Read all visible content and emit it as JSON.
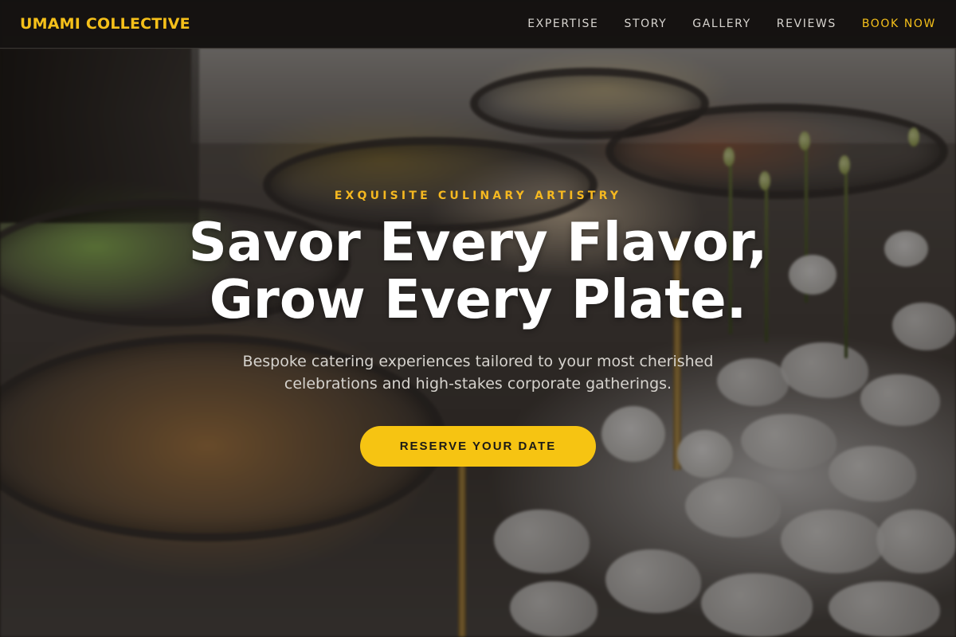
{
  "brand": {
    "name": "UMAMI COLLECTIVE",
    "accent_color": "#f5c01a"
  },
  "nav": {
    "links": [
      {
        "label": "EXPERTISE"
      },
      {
        "label": "STORY"
      },
      {
        "label": "GALLERY"
      },
      {
        "label": "REVIEWS"
      },
      {
        "label": "BOOK NOW"
      }
    ]
  },
  "hero": {
    "eyebrow": "EXQUISITE CULINARY ARTISTRY",
    "headline_line1": "Savor Every Flavor,",
    "headline_line2": "Grow Every Plate.",
    "subtext": "Bespoke catering experiences tailored to your most cherished celebrations and high-stakes corporate gatherings.",
    "cta_label": "RESERVE YOUR DATE",
    "background_image": "catering buffet with chafing dishes, salads and white flowers"
  }
}
